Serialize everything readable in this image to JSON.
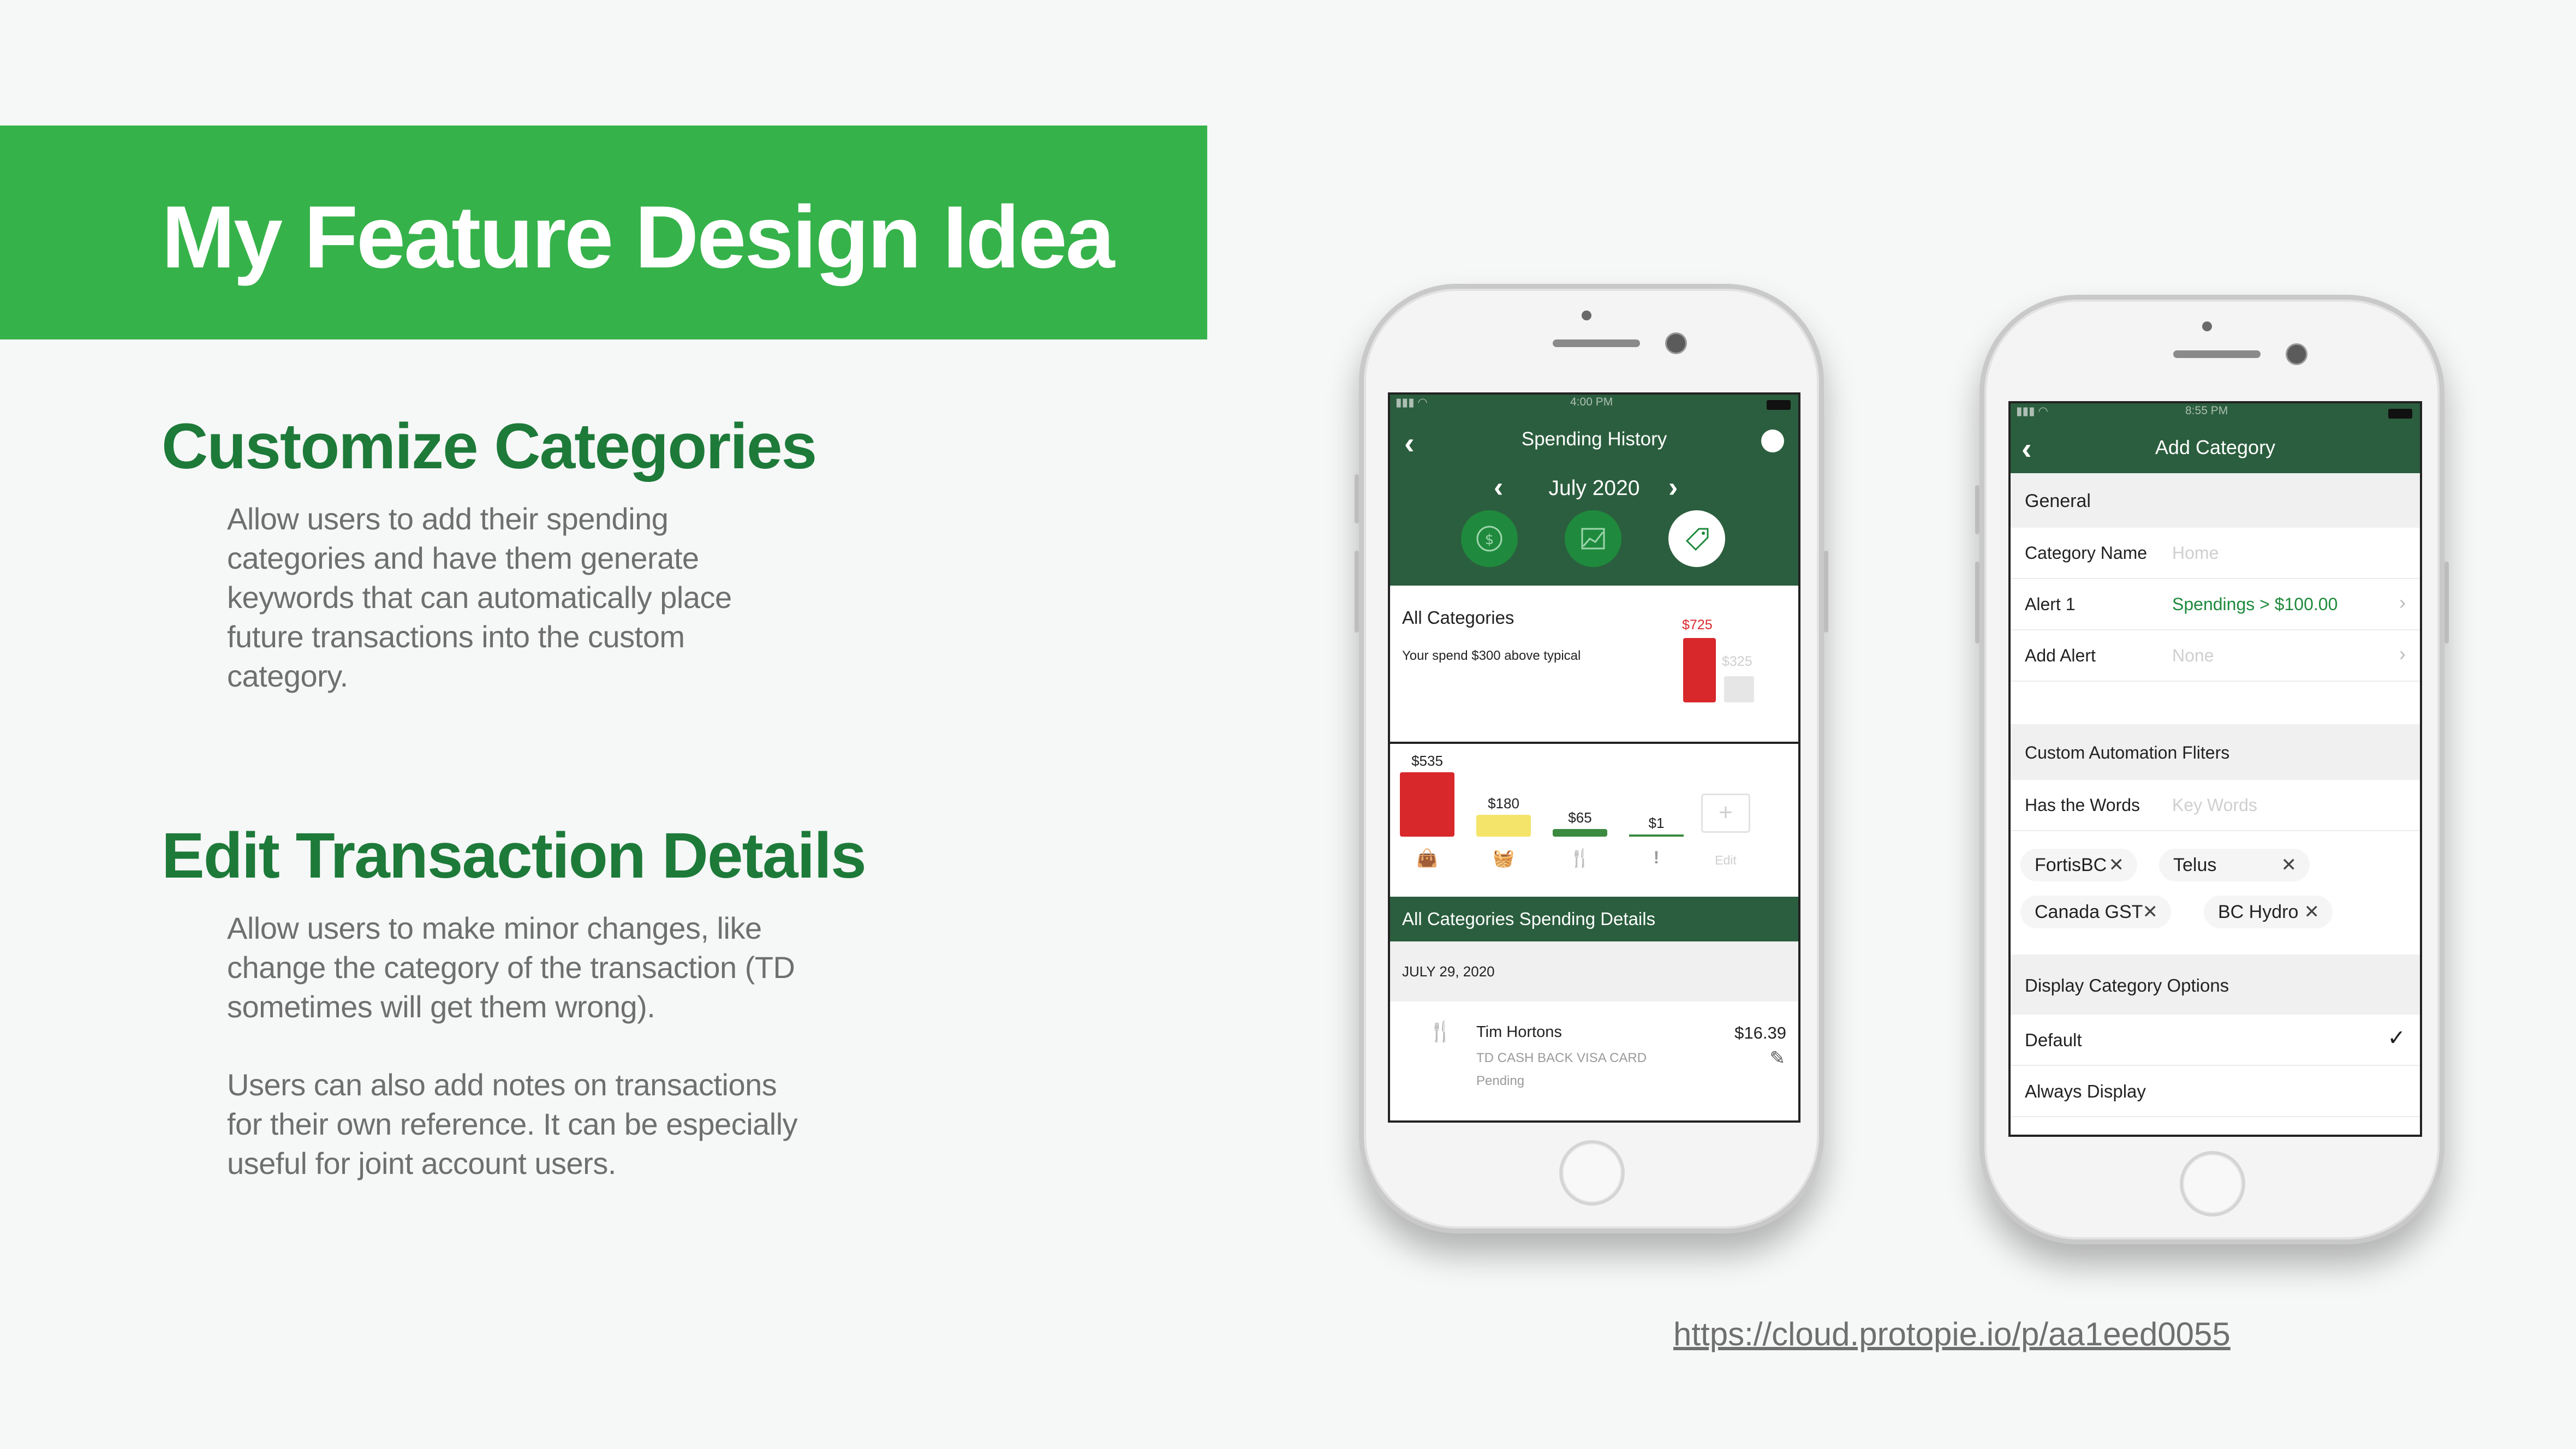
{
  "slide": {
    "title": "My Feature Design Idea",
    "sections": [
      {
        "heading": "Customize Categories",
        "lines": [
          "Allow users to add their spending",
          "categories and have them generate",
          "keywords that can automatically place",
          "future transactions into the custom",
          "category."
        ]
      },
      {
        "heading": "Edit Transaction Details",
        "lines": [
          "Allow users to make minor changes, like",
          "change the category of the transaction (TD",
          "sometimes will get them wrong)."
        ],
        "lines2": [
          "Users can also add notes on transactions",
          "for their own reference. It can be especially",
          "useful for joint account users."
        ]
      }
    ],
    "link": "https://cloud.protopie.io/p/aa1eed0055"
  },
  "phone1": {
    "time": "4:00 PM",
    "title": "Spending History",
    "month": "July 2020",
    "icons": [
      "dollar-coin-icon",
      "growth-chart-icon",
      "price-tag-icon"
    ],
    "summary": {
      "title": "All Categories",
      "note": "Your spend $300 above typical",
      "current": "$725",
      "typical": "$325"
    },
    "categories": [
      {
        "amount": "$535",
        "value": 535,
        "color": "#d8282c",
        "icon": "shopping-bag-icon"
      },
      {
        "amount": "$180",
        "value": 180,
        "color": "#f4e46a",
        "icon": "basket-icon"
      },
      {
        "amount": "$65",
        "value": 65,
        "color": "#3a8a3f",
        "icon": "fork-knife-icon"
      },
      {
        "amount": "$1",
        "value": 1,
        "color": "#3a8a3f",
        "icon": "alert-icon"
      }
    ],
    "edit_label": "Edit",
    "details_header": "All Categories Spending Details",
    "date": "JULY 29, 2020",
    "transaction": {
      "merchant": "Tim Hortons",
      "amount": "$16.39",
      "card": "TD CASH BACK VISA CARD",
      "status": "Pending"
    }
  },
  "phone2": {
    "time": "8:55 PM",
    "title": "Add Category",
    "general_header": "General",
    "rows": [
      {
        "label": "Category Name",
        "value": "Home"
      },
      {
        "label": "Alert 1",
        "value": "Spendings > $100.00"
      },
      {
        "label": "Add Alert",
        "value": "None"
      }
    ],
    "filters_header": "Custom Automation Fliters",
    "has_words_label": "Has the Words",
    "has_words_placeholder": "Key Words",
    "chips": [
      "FortisBC",
      "Telus",
      "Canada GST",
      "BC Hydro"
    ],
    "display_header": "Display Category Options",
    "options": [
      {
        "label": "Default",
        "checked": true
      },
      {
        "label": "Always Display",
        "checked": false
      }
    ]
  },
  "colors": {
    "banner": "#36b24a",
    "heading": "#1d7a39",
    "app_header": "#2b5e3e",
    "accent_green": "#1f8a3d",
    "alert_red": "#d8282c"
  }
}
